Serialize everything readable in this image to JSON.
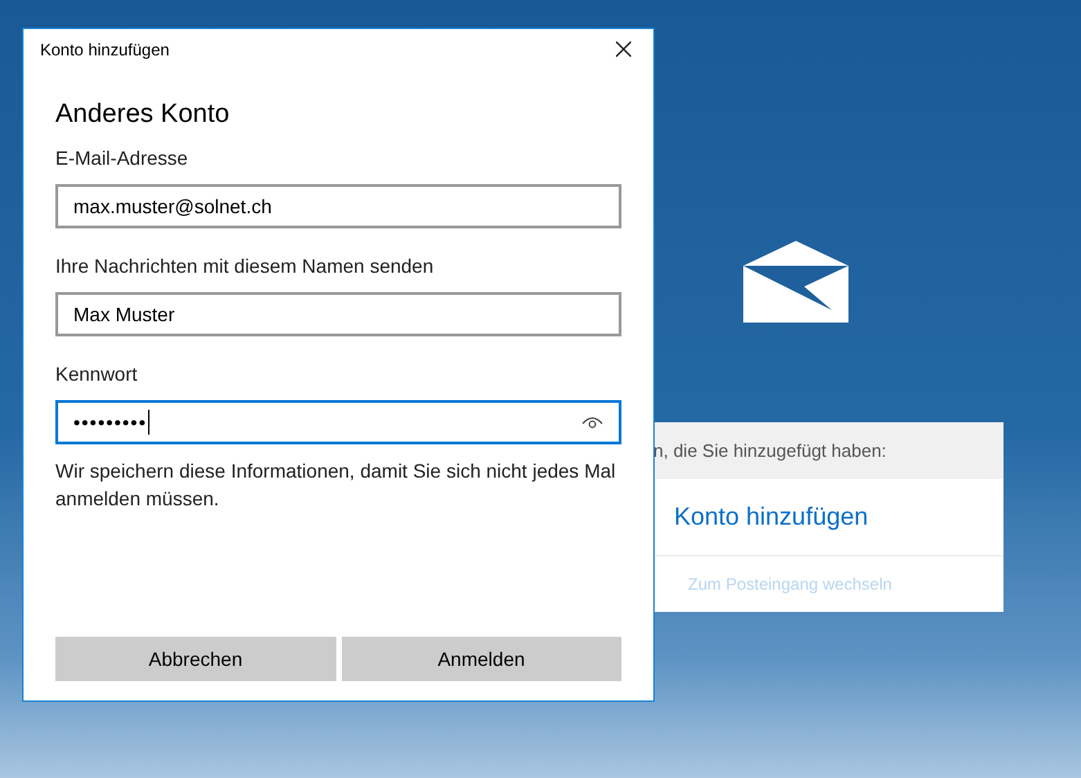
{
  "dialog": {
    "title": "Konto hinzufügen",
    "heading": "Anderes Konto",
    "fields": [
      {
        "label": "E-Mail-Adresse",
        "value": "max.muster@solnet.ch",
        "focused": false,
        "kind": "text"
      },
      {
        "label": "Ihre Nachrichten mit diesem Namen senden",
        "value": "Max Muster",
        "focused": false,
        "kind": "text"
      },
      {
        "label": "Kennwort",
        "value": "•••••••••",
        "focused": true,
        "kind": "password"
      }
    ],
    "note": "Wir speichern diese Informationen, damit Sie sich nicht jedes Mal anmelden müssen.",
    "buttons": [
      "Abbrechen",
      "Anmelden"
    ]
  },
  "background_panel": {
    "header": "n, die Sie hinzugefügt haben:",
    "add_account_link": "Konto hinzufügen",
    "inbox_link": {
      "label": "Zum Posteingang wechseln",
      "disabled": true
    }
  }
}
